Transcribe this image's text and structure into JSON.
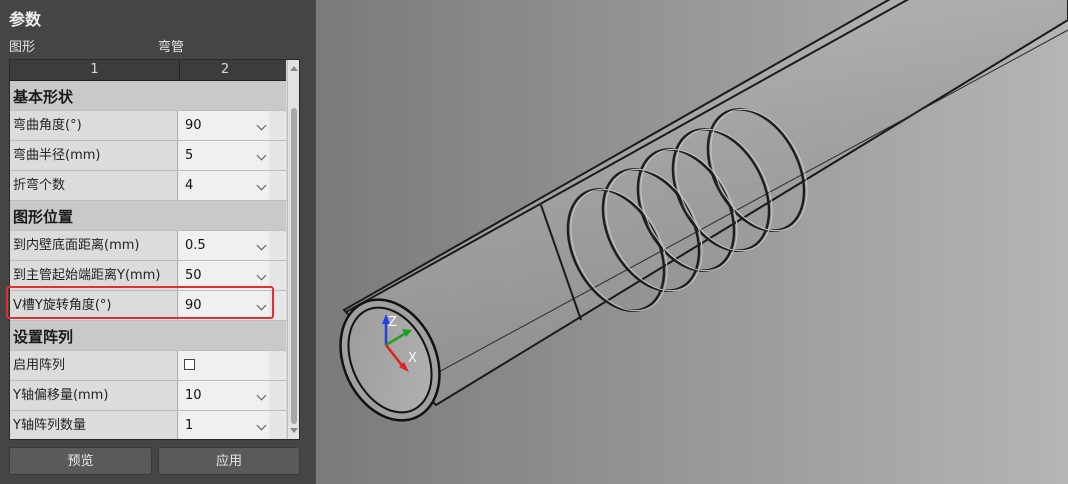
{
  "panel": {
    "title": "参数",
    "shape_label": "图形",
    "shape_value": "弯管",
    "columns": [
      "1",
      "2"
    ],
    "sections": {
      "basic": {
        "title": "基本形状",
        "bend_angle": {
          "label": "弯曲角度(°)",
          "value": "90"
        },
        "bend_radius": {
          "label": "弯曲半径(mm)",
          "value": "5"
        },
        "bend_count": {
          "label": "折弯个数",
          "value": "4"
        }
      },
      "position": {
        "title": "图形位置",
        "inner_wall": {
          "label": "到内壁底面距离(mm)",
          "value": "0.5"
        },
        "main_start": {
          "label": "到主管起始端距离Y(mm)",
          "value": "50"
        },
        "v_rotate": {
          "label": "V槽Y旋转角度(°)",
          "value": "90"
        }
      },
      "array": {
        "title": "设置阵列",
        "enable": {
          "label": "启用阵列",
          "checked": false
        },
        "y_offset": {
          "label": "Y轴偏移量(mm)",
          "value": "10"
        },
        "y_count": {
          "label": "Y轴阵列数量",
          "value": "1"
        }
      }
    },
    "buttons": {
      "preview": "预览",
      "apply": "应用"
    }
  },
  "viewport": {
    "axes": {
      "x": "X",
      "y": "Y",
      "z": "Z"
    },
    "colors": {
      "x": "#e02020",
      "y": "#20a020",
      "z": "#2040e0"
    }
  }
}
